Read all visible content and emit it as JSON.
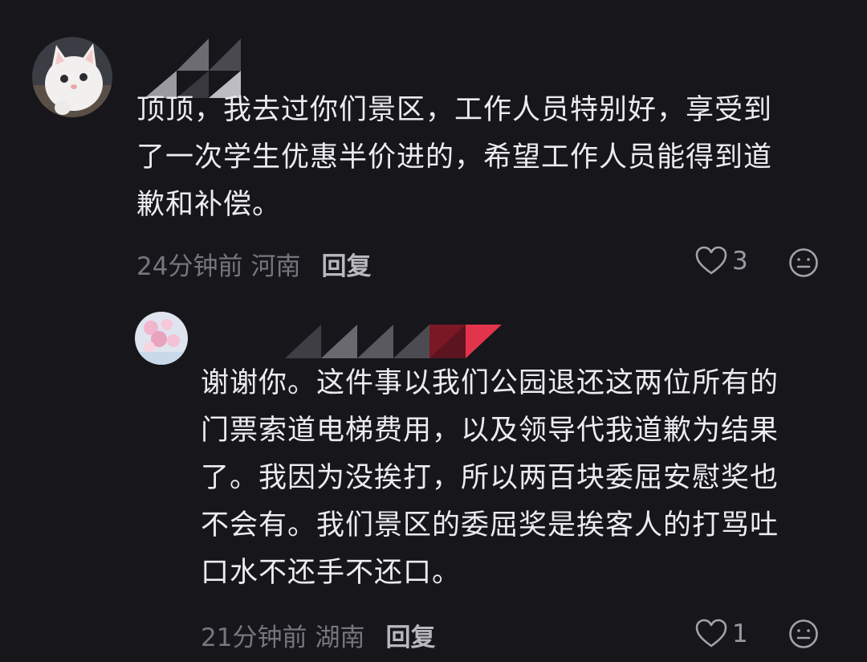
{
  "comments": [
    {
      "text_lines": [
        "顶顶，我去过你们景区，工作人员特别好，享受到",
        "了一次学生优惠半价进的，希望工作人员能得到道",
        "歉和补偿。"
      ],
      "time": "24分钟前",
      "location": "河南",
      "reply_label": "回复",
      "likes": "3",
      "avatar_icon": "white-cat-avatar"
    },
    {
      "text_lines": [
        "谢谢你。这件事以我们公园退还这两位所有的",
        "门票索道电梯费用，以及领导代我道歉为结果",
        "了。我因为没挨打，所以两百块委屈安慰奖也",
        "不会有。我们景区的委屈奖是挨客人的打骂吐",
        "口水不还手不还口。"
      ],
      "time": "21分钟前",
      "location": "湖南",
      "reply_label": "回复",
      "likes": "1",
      "avatar_icon": "pink-flower-avatar"
    }
  ],
  "colors": {
    "background": "#17161b",
    "text": "#ecebef",
    "meta": "#77767d",
    "reply": "#b9b8be",
    "mask_accent": "#e2344a"
  }
}
